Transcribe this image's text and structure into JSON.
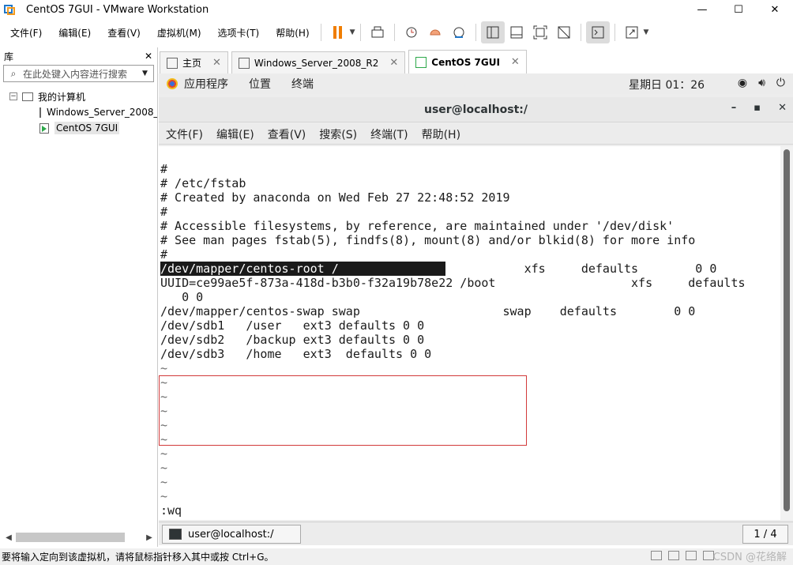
{
  "window": {
    "title": "CentOS 7GUI - VMware Workstation",
    "controls": [
      "—",
      "☐",
      "✕"
    ]
  },
  "menu": {
    "items": [
      "文件(F)",
      "编辑(E)",
      "查看(V)",
      "虚拟机(M)",
      "选项卡(T)",
      "帮助(H)"
    ]
  },
  "library": {
    "title": "库",
    "close": "✕",
    "search_placeholder": "在此处键入内容进行搜索",
    "tree": {
      "root": "我的计算机",
      "vms": [
        "Windows_Server_2008_R2",
        "CentOS 7GUI"
      ],
      "selected": "CentOS 7GUI"
    }
  },
  "tabs": [
    {
      "label": "主页",
      "active": false
    },
    {
      "label": "Windows_Server_2008_R2",
      "active": false
    },
    {
      "label": "CentOS 7GUI",
      "active": true
    }
  ],
  "guest": {
    "top_bar": {
      "items": [
        "应用程序",
        "位置",
        "终端"
      ],
      "clock": "星期日 01：26"
    },
    "terminal": {
      "title": "user@localhost:/",
      "controls": [
        "–",
        "▪",
        "✕"
      ],
      "menu": [
        "文件(F)",
        "编辑(E)",
        "查看(V)",
        "搜索(S)",
        "终端(T)",
        "帮助(H)"
      ],
      "lines": [
        "#",
        "# /etc/fstab",
        "# Created by anaconda on Wed Feb 27 22:48:52 2019",
        "#",
        "# Accessible filesystems, by reference, are maintained under '/dev/disk'",
        "# See man pages fstab(5), findfs(8), mount(8) and/or blkid(8) for more info",
        "#"
      ],
      "highlighted_line": "/dev/mapper/centos-root /               ",
      "highlighted_rest": "           xfs     defaults        0 0",
      "uuid_line": "UUID=ce99ae5f-873a-418d-b3b0-f32a19b78e22 /boot                   xfs     defaults",
      "uuid_cont": "   0 0",
      "boxed_lines": [
        "/dev/mapper/centos-swap swap                    swap    defaults        0 0",
        "/dev/sdb1   /user   ext3 defaults 0 0",
        "/dev/sdb2   /backup ext3 defaults 0 0",
        "/dev/sdb3   /home   ext3  defaults 0 0"
      ],
      "tilde": "~",
      "command": ":wq"
    },
    "taskbar": {
      "task": "user@localhost:/",
      "pager": "1 / 4"
    }
  },
  "statusbar": {
    "message": "要将输入定向到该虚拟机，请将鼠标指针移入其中或按 Ctrl+G。",
    "watermark": "CSDN @花络解"
  }
}
